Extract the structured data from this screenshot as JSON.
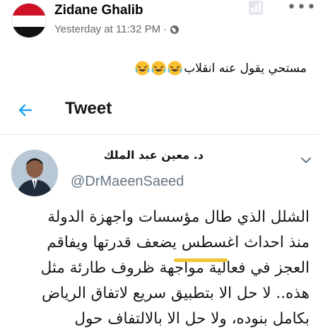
{
  "post": {
    "author_name": "Zidane Ghalib",
    "timestamp": "Yesterday at 11:32 PM",
    "separator": "·",
    "privacy_icon": "globe-icon",
    "caption": "مستحي يقول عنه انقلاب",
    "caption_emoji": [
      "laughing-emoji",
      "laughing-emoji",
      "laughing-emoji"
    ]
  },
  "tweet": {
    "back_icon": "arrow-left-icon",
    "header_title": "Tweet",
    "author_name": "د. معين عبد الملك",
    "handle": "@DrMaeenSaeed",
    "body_lines": [
      "الشلل الذي طال مؤسسات واجهزة الدولة",
      "منذ احداث اغسطس يضعف قدرتها ويفاقم",
      "العجز في فعالية مواجهة ظروف طارئة مثل",
      "هذه.. لا حل الا بتطبيق سريع لاتفاق الرياض",
      "بكامل بنوده، ولا حل الا بالالتفاف حول"
    ]
  },
  "colors": {
    "twitter_blue": "#1da1f2",
    "meta_gray": "#65676b",
    "highlight_yellow": "#f2c12e"
  }
}
